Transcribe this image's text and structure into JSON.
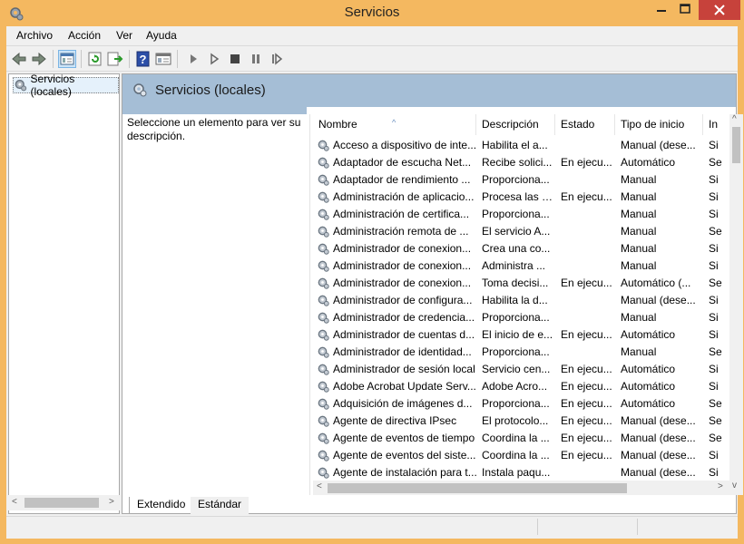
{
  "window": {
    "title": "Servicios"
  },
  "menu": {
    "items": [
      "Archivo",
      "Acción",
      "Ver",
      "Ayuda"
    ]
  },
  "toolbar": {
    "icons": [
      "back-icon",
      "forward-icon",
      "show-console-tree-icon",
      "refresh-icon",
      "export-list-icon",
      "help-icon",
      "properties-icon",
      "start-service-icon",
      "start-service-alt-icon",
      "stop-service-icon",
      "pause-service-icon",
      "restart-service-icon"
    ]
  },
  "tree": {
    "root_label": "Servicios (locales)"
  },
  "pane": {
    "title": "Servicios (locales)",
    "description_prompt": "Seleccione un elemento para ver su descripción."
  },
  "columns": {
    "name": "Nombre",
    "description": "Descripción",
    "status": "Estado",
    "startup": "Tipo de inicio",
    "logon": "In"
  },
  "services": [
    {
      "name": "Acceso a dispositivo de inte...",
      "description": "Habilita el a...",
      "status": "",
      "startup": "Manual (dese...",
      "logon": "Si"
    },
    {
      "name": "Adaptador de escucha Net...",
      "description": "Recibe solici...",
      "status": "En ejecu...",
      "startup": "Automático",
      "logon": "Se"
    },
    {
      "name": "Adaptador de rendimiento ...",
      "description": "Proporciona...",
      "status": "",
      "startup": "Manual",
      "logon": "Si"
    },
    {
      "name": "Administración de aplicacio...",
      "description": "Procesa las s...",
      "status": "En ejecu...",
      "startup": "Manual",
      "logon": "Si"
    },
    {
      "name": "Administración de certifica...",
      "description": "Proporciona...",
      "status": "",
      "startup": "Manual",
      "logon": "Si"
    },
    {
      "name": "Administración remota de ...",
      "description": "El servicio A...",
      "status": "",
      "startup": "Manual",
      "logon": "Se"
    },
    {
      "name": "Administrador de conexion...",
      "description": "Crea una co...",
      "status": "",
      "startup": "Manual",
      "logon": "Si"
    },
    {
      "name": "Administrador de conexion...",
      "description": "Administra ...",
      "status": "",
      "startup": "Manual",
      "logon": "Si"
    },
    {
      "name": "Administrador de conexion...",
      "description": "Toma decisi...",
      "status": "En ejecu...",
      "startup": "Automático (...",
      "logon": "Se"
    },
    {
      "name": "Administrador de configura...",
      "description": "Habilita la d...",
      "status": "",
      "startup": "Manual (dese...",
      "logon": "Si"
    },
    {
      "name": "Administrador de credencia...",
      "description": "Proporciona...",
      "status": "",
      "startup": "Manual",
      "logon": "Si"
    },
    {
      "name": "Administrador de cuentas d...",
      "description": "El inicio de e...",
      "status": "En ejecu...",
      "startup": "Automático",
      "logon": "Si"
    },
    {
      "name": "Administrador de identidad...",
      "description": "Proporciona...",
      "status": "",
      "startup": "Manual",
      "logon": "Se"
    },
    {
      "name": "Administrador de sesión local",
      "description": "Servicio cen...",
      "status": "En ejecu...",
      "startup": "Automático",
      "logon": "Si"
    },
    {
      "name": "Adobe Acrobat Update Serv...",
      "description": "Adobe Acro...",
      "status": "En ejecu...",
      "startup": "Automático",
      "logon": "Si"
    },
    {
      "name": "Adquisición de imágenes d...",
      "description": "Proporciona...",
      "status": "En ejecu...",
      "startup": "Automático",
      "logon": "Se"
    },
    {
      "name": "Agente de directiva IPsec",
      "description": "El protocolo...",
      "status": "En ejecu...",
      "startup": "Manual (dese...",
      "logon": "Se"
    },
    {
      "name": "Agente de eventos de tiempo",
      "description": "Coordina la ...",
      "status": "En ejecu...",
      "startup": "Manual (dese...",
      "logon": "Se"
    },
    {
      "name": "Agente de eventos del siste...",
      "description": "Coordina la ...",
      "status": "En ejecu...",
      "startup": "Manual (dese...",
      "logon": "Si"
    },
    {
      "name": "Agente de instalación para t...",
      "description": "Instala paqu...",
      "status": "",
      "startup": "Manual (dese...",
      "logon": "Si"
    }
  ],
  "tabs": [
    "Extendido",
    "Estándar"
  ],
  "colors": {
    "titlebar": "#f4b860",
    "close_button": "#c7423b",
    "pane_header": "#a5bed6"
  }
}
